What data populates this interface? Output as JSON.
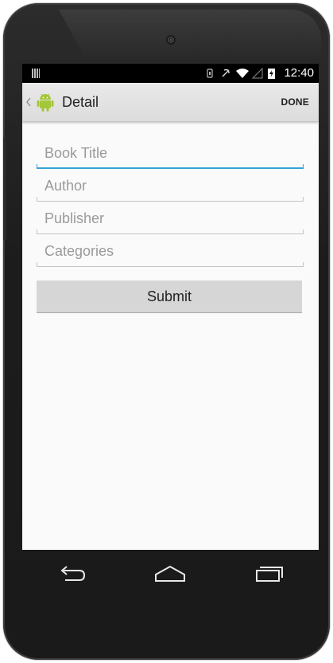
{
  "status_bar": {
    "time": "12:40",
    "icons": [
      "signal-bars-icon",
      "vibrate-icon",
      "alarm-icon",
      "wifi-icon",
      "cell-signal-icon",
      "battery-charging-icon"
    ]
  },
  "action_bar": {
    "title": "Detail",
    "done_label": "DONE",
    "app_icon": "android-robot-icon"
  },
  "form": {
    "fields": [
      {
        "placeholder": "Book Title",
        "value": "",
        "focused": true
      },
      {
        "placeholder": "Author",
        "value": "",
        "focused": false
      },
      {
        "placeholder": "Publisher",
        "value": "",
        "focused": false
      },
      {
        "placeholder": "Categories",
        "value": "",
        "focused": false
      }
    ],
    "submit_label": "Submit"
  },
  "nav_bar": {
    "icons": [
      "back-icon",
      "home-icon",
      "recents-icon"
    ]
  },
  "colors": {
    "accent": "#33a3d6",
    "action_bar": "#dcdcdc",
    "button": "#d6d6d6",
    "android_green": "#a4c639"
  }
}
